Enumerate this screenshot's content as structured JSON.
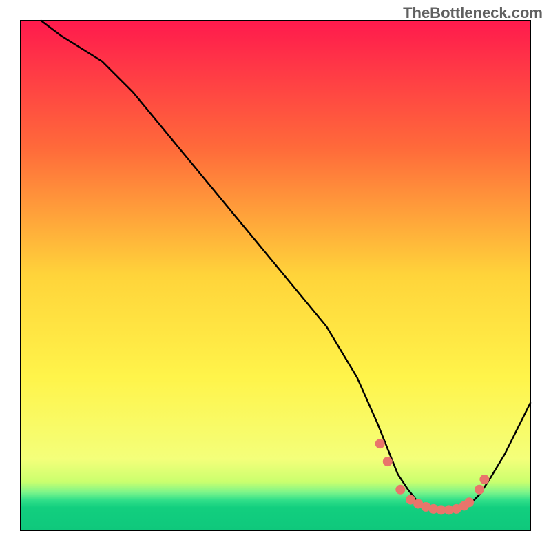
{
  "watermark": "TheBottleneck.com",
  "chart_data": {
    "type": "line",
    "title": "",
    "xlabel": "",
    "ylabel": "",
    "xlim": [
      0,
      100
    ],
    "ylim": [
      0,
      100
    ],
    "frame": {
      "stroke": "#000000",
      "width": 2
    },
    "plot_background": {
      "type": "vertical-gradient",
      "stops": [
        {
          "offset": 0.0,
          "color": "#ff1a4d"
        },
        {
          "offset": 0.25,
          "color": "#ff6a3a"
        },
        {
          "offset": 0.5,
          "color": "#ffd43a"
        },
        {
          "offset": 0.7,
          "color": "#fff44a"
        },
        {
          "offset": 0.86,
          "color": "#f4ff7a"
        },
        {
          "offset": 0.905,
          "color": "#caff6e"
        },
        {
          "offset": 0.925,
          "color": "#7ef58a"
        },
        {
          "offset": 0.94,
          "color": "#33e08a"
        },
        {
          "offset": 0.955,
          "color": "#12cf7f"
        },
        {
          "offset": 1.0,
          "color": "#0fc87c"
        }
      ]
    },
    "curve": {
      "stroke": "#000000",
      "width": 2.5,
      "points_xy": [
        [
          4,
          100
        ],
        [
          8,
          97
        ],
        [
          16,
          92
        ],
        [
          22,
          86
        ],
        [
          60,
          40
        ],
        [
          66,
          30
        ],
        [
          70,
          21
        ],
        [
          72,
          16
        ],
        [
          74,
          11
        ],
        [
          76,
          8
        ],
        [
          78,
          5.5
        ],
        [
          80,
          4.3
        ],
        [
          82,
          3.8
        ],
        [
          84,
          3.6
        ],
        [
          86,
          4.0
        ],
        [
          88,
          5.0
        ],
        [
          90,
          7.0
        ],
        [
          92,
          10.0
        ],
        [
          95,
          15.0
        ],
        [
          98,
          21.0
        ],
        [
          100,
          25.0
        ]
      ]
    },
    "marker_series": {
      "color": "#e9756b",
      "radius": 7,
      "points_xy": [
        [
          70.5,
          17.0
        ],
        [
          72.0,
          13.5
        ],
        [
          74.5,
          8.0
        ],
        [
          76.5,
          6.0
        ],
        [
          78.0,
          5.2
        ],
        [
          79.5,
          4.6
        ],
        [
          81.0,
          4.2
        ],
        [
          82.5,
          4.0
        ],
        [
          84.0,
          4.0
        ],
        [
          85.5,
          4.2
        ],
        [
          87.0,
          4.8
        ],
        [
          88.0,
          5.5
        ],
        [
          90.0,
          8.0
        ],
        [
          91.0,
          10.0
        ]
      ]
    }
  }
}
